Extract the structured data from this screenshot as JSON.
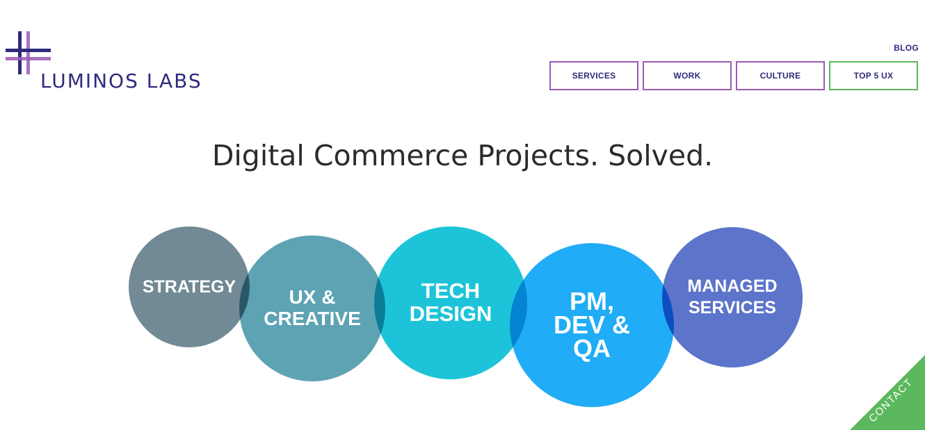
{
  "logo": {
    "text": "LUMINOS LABS",
    "color": "#2e2a7a",
    "accent": "#9b59b6"
  },
  "nav": {
    "blog": "BLOG",
    "items": [
      {
        "label": "SERVICES"
      },
      {
        "label": "WORK"
      },
      {
        "label": "CULTURE"
      },
      {
        "label": "TOP 5 UX"
      }
    ],
    "border_color": "#9b59b6",
    "highlight_color": "#5cb85c"
  },
  "headline": "Digital Commerce Projects. Solved.",
  "circles": [
    {
      "label": "STRATEGY",
      "color": "#65808c"
    },
    {
      "label": "UX &\nCREATIVE",
      "color": "#4896aa"
    },
    {
      "label": "TECH\nDESIGN",
      "color": "#0cc0d6"
    },
    {
      "label": "PM,\nDEV &\nQA",
      "color": "#14a8f5"
    },
    {
      "label": "MANAGED\nSERVICES",
      "color": "#4e68c4"
    }
  ],
  "contact": {
    "label": "CONTACT",
    "color": "#5cb85c"
  }
}
